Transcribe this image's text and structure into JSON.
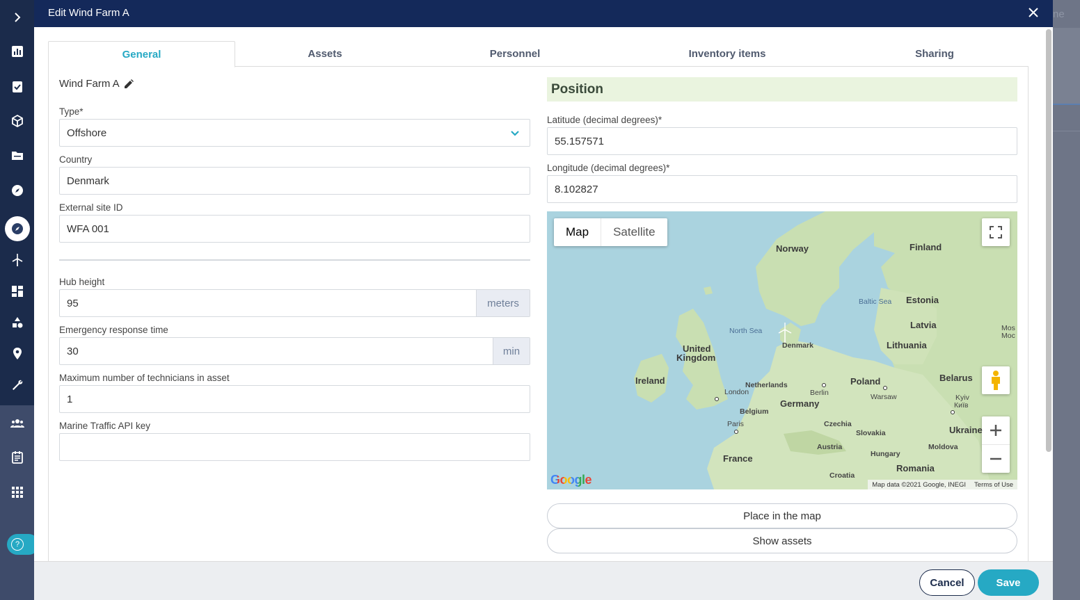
{
  "modal": {
    "title": "Edit Wind Farm A"
  },
  "background": {
    "title_fragment": "ne"
  },
  "tabs": [
    {
      "label": "General",
      "active": true
    },
    {
      "label": "Assets"
    },
    {
      "label": "Personnel"
    },
    {
      "label": "Inventory items"
    },
    {
      "label": "Sharing"
    }
  ],
  "general": {
    "farm_name": "Wind Farm A",
    "type": {
      "label": "Type*",
      "value": "Offshore"
    },
    "country": {
      "label": "Country",
      "value": "Denmark"
    },
    "external_site_id": {
      "label": "External site ID",
      "value": "WFA 001"
    },
    "hub_height": {
      "label": "Hub height",
      "value": "95",
      "unit": "meters"
    },
    "emergency_response_time": {
      "label": "Emergency response time",
      "value": "30",
      "unit": "min"
    },
    "max_technicians": {
      "label": "Maximum number of technicians in asset",
      "value": "1"
    },
    "marine_traffic_key": {
      "label": "Marine Traffic API key",
      "value": ""
    }
  },
  "position": {
    "header": "Position",
    "latitude": {
      "label": "Latitude (decimal degrees)*",
      "value": "55.157571"
    },
    "longitude": {
      "label": "Longitude (decimal degrees)*",
      "value": "8.102827"
    },
    "map": {
      "type_map": "Map",
      "type_satellite": "Satellite",
      "countries": [
        "Norway",
        "Finland",
        "Estonia",
        "Latvia",
        "Lithuania",
        "United",
        "Kingdom",
        "Denmark",
        "Ireland",
        "Netherlands",
        "Poland",
        "Belarus",
        "Germany",
        "Belgium",
        "Czechia",
        "Slovakia",
        "Ukraine",
        "Austria",
        "Hungary",
        "Moldova",
        "France",
        "Romania",
        "Croatia"
      ],
      "cities": [
        "London",
        "Berlin",
        "Warsaw",
        "Paris",
        "Kyiv",
        "Київ",
        "Mos",
        "Moc"
      ],
      "seas": [
        "Baltic Sea",
        "North Sea"
      ],
      "logo": "Google",
      "attribution": "Map data ©2021 Google, INEGI",
      "terms": "Terms of Use"
    },
    "place_in_map": "Place in the map",
    "show_assets": "Show assets"
  },
  "footer": {
    "cancel": "Cancel",
    "save": "Save"
  },
  "colors": {
    "accent": "#26a9c4",
    "header": "#14295a",
    "sidebar": "#1b2b4b",
    "position_bg": "#eaf4df"
  },
  "sidebar_icons": [
    "chevron-right-icon",
    "bar-chart-icon",
    "clipboard-check-icon",
    "box-icon",
    "folder-icon",
    "compass-icon",
    "compass-active-icon",
    "wind-turbine-icon",
    "dashboard-icon",
    "shapes-icon",
    "location-pin-icon",
    "wrench-icon",
    "people-icon",
    "report-icon",
    "apps-grid-icon",
    "help-icon"
  ]
}
